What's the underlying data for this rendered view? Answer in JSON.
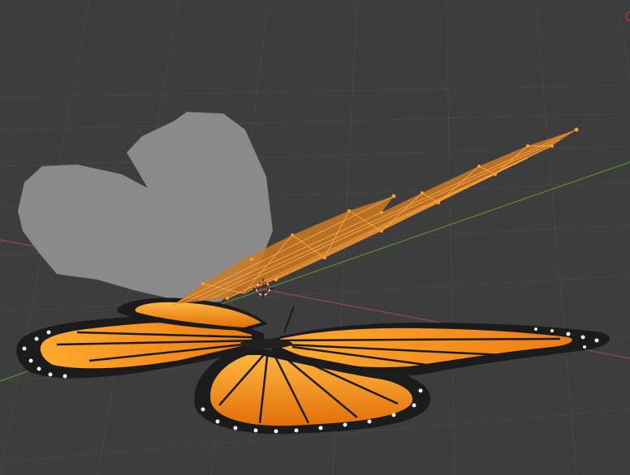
{
  "app": "3D viewport",
  "scene": {
    "objects": [
      {
        "name": "butterfly",
        "type": "textured-plane-mesh"
      },
      {
        "name": "wing-shape",
        "type": "grey-mesh"
      },
      {
        "name": "selected-wing-mesh",
        "type": "edit-mode-mesh",
        "selected": true
      }
    ],
    "axes": {
      "x_axis_color": "#b04a5a",
      "y_axis_color": "#6a9a3a"
    }
  },
  "colors": {
    "background": "#3d3d3d",
    "grid": "#4a4a4a",
    "selection": "#ff8c1a",
    "wing_orange": "#f7941d",
    "wing_black": "#1b1b1b",
    "grey_mesh": "#8c8c8c"
  }
}
